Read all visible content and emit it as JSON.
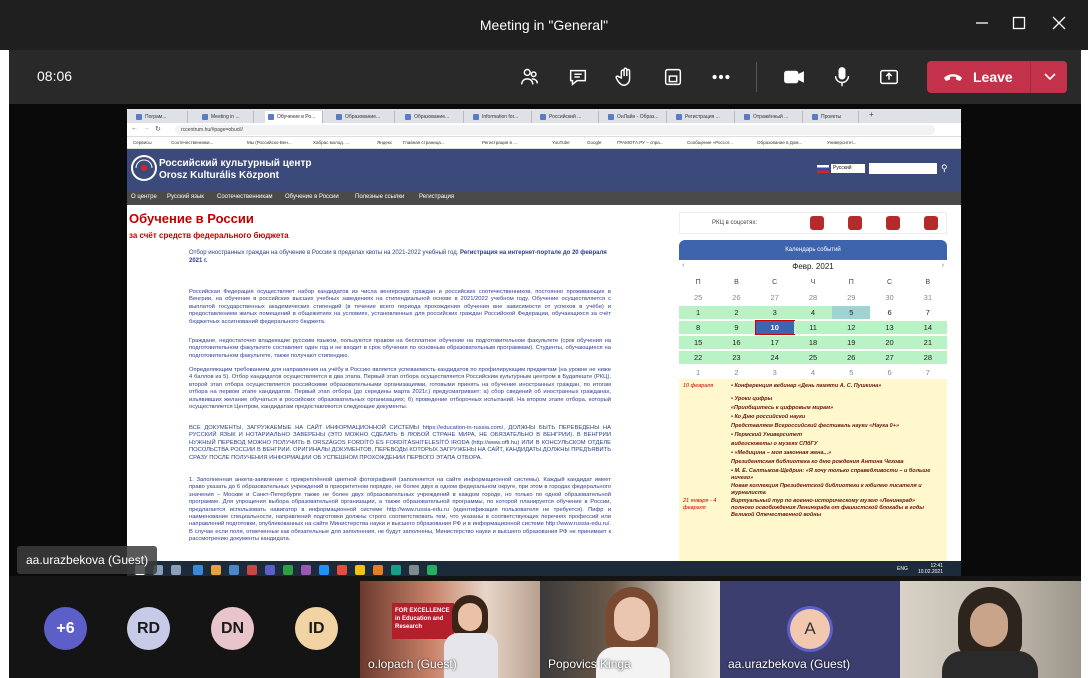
{
  "window": {
    "title": "Meeting in \"General\""
  },
  "toolbar": {
    "timer": "08:06",
    "leave_label": "Leave"
  },
  "browser": {
    "tabs": [
      "Пограм...",
      "Meeting in ...",
      "Обучение в Ро...",
      "Образование...",
      "Образование...",
      "Information for...",
      "Российский ...",
      "ОнЛайн - Образ...",
      "Регистрация ...",
      "Отражённый ...",
      "Проекты"
    ],
    "address": "rccentrum.hu/#page=obucil/",
    "bookmarks": [
      "Сервисы",
      "Соотечественники...",
      "Мы (Российско-Вен...",
      "Хабрас молод. ...",
      "Яндекс",
      "Главная страница...",
      "Регистрация в ...",
      "YouTube",
      "Google",
      "ГРАМОТА.РУ – спра...",
      "Сообщение «Россот...",
      "Образование в Дом...",
      "Университет..."
    ]
  },
  "site": {
    "name_ru": "Российский культурный центр",
    "name_hu": "Orosz Kulturális Központ",
    "language": "Русский",
    "nav": [
      "О центре",
      "Русский язык",
      "Соотечественникам",
      "Обучение в России",
      "Полезные ссылки",
      "Регистрация"
    ],
    "heading": "Обучение в России",
    "subheading": "за счёт средств федерального бюджета",
    "intro_plain": "Отбор иностранных граждан на обучение в России в пределах квоты на 2021-2022 учебный год. ",
    "intro_bold": "Регистрация на интернет-портале до 20 февраля 2021 г.",
    "paragraphs": [
      "Российская Федерация осуществляет набор кандидатов из числа венгерских граждан и российских соотечественников, постоянно проживающих в Венгрии, на обучение в российских высших учебных заведениях на стипендиальной основе в 2021/2022 учебном году. Обучение осуществляется с выплатой государственных академических стипендий (в течение всего периода прохождения обучения вне зависимости от успехов в учёбе) и предоставлением жилых помещений в общежитиях на условиях, установленных для российских граждан Российской Федерации, обучающихся за счёт бюджетных ассигнований федерального бюджета.",
      "Граждане, недостаточно владеющие русским языком, пользуются правом на бесплатное обучение на подготовительном факультете (срок обучения на подготовительном факультете составляет один год и не входит в срок обучения по основным образовательным программам). Студенты, обучающиеся на подготовительном факультете, также получают стипендию.",
      "Определяющим требованием для направления на учёбу в Россию является успеваемость кандидатов по профилирующим предметам (на уровне не ниже 4 баллов из 5). Отбор кандидатов осуществляется в два этапа. Первый этап отбора осуществляется Российским культурным центром в Будапеште (РКЦ), второй этап отбора осуществляется российскими образовательными организациями, готовыми принять на обучение иностранных граждан, по итогам отбора на первом этапе кандидатов. Первый этап отбора (до середины марта 2021г.) предусматривает: а) сбор сведений об иностранных гражданах, изъявивших желание обучаться в российских образовательных организациях; б) проведение отборочных испытаний. На втором этапе отбора, который осуществляется Центром, кандидатам предоставляются следующие документы.",
      "ВСЕ ДОКУМЕНТЫ, ЗАГРУЖАЕМЫЕ НА САЙТ ИНФОРМАЦИОННОЙ СИСТЕМЫ https://education-in-russia.com/, ДОЛЖНЫ БЫТЬ ПЕРЕВЕДЕНЫ НА РУССКИЙ ЯЗЫК И НОТАРИАЛЬНО ЗАВЕРЕНЫ (ЭТО МОЖНО СДЕЛАТЬ В ЛЮБОЙ СТРАНЕ МИРА, НЕ ОБЯЗАТЕЛЬНО В ВЕНГРИИ). В ВЕНГРИИ НУЖНЫЙ ПЕРЕВОД МОЖНО ПОЛУЧИТЬ В ORSZÁGOS FORDÍTÓ ÉS FORDÍTÁSHITELESÍTŐ IRODA (http://www.offi.hu) ИЛИ В КОНСУЛЬСКОМ ОТДЕЛЕ ПОСОЛЬСТВА РОССИИ В ВЕНГРИИ. ОРИГИНАЛЫ ДОКУМЕНТОВ, ПЕРЕВОДЫ КОТОРЫХ ЗАГРУЖЕНЫ НА САЙТ, КАНДИДАТЫ ДОЛЖНЫ ПРЕДЪЯВИТЬ СРАЗУ ПОСЛЕ ПОЛУЧЕНИЯ ИНФОРМАЦИИ ОБ УСПЕШНОМ ПРОХОЖДЕНИИ ПЕРВОГО ЭТАПА ОТБОРА.",
      "1. Заполненная анкета-заявление с прикреплённой цветной фотографией (заполняется на сайте информационной системы). Каждый кандидат имеет право указать до 6 образовательных учреждений в приоритетном порядке, не более двух в одном федеральном округе, при этом в городах федерального значения – Москве и Санкт-Петербурге также не более двух образовательных учреждений в каждом городе, но только по одной образовательной программе. Для упрощения выбора образовательной организации, а также образовательной программы, по которой планируется обучение в России, предлагается использовать навигатор в информационной системе http://www.russia-edu.ru (идентификация пользователя не требуется). Пифр и наименование специальности, направлений подготовки должны строго соответствовать тем, что указаны в соответствующих перечнях профессий или направлений подготовки, опубликованных на сайте Министерства науки и высшего образования РФ и в информационной системе http://www.russia-edu.ru/. В случае если поля, отмеченные как обязательные для заполнения, не будут заполнены, Министерство науки и высшего образования РФ не принимает к рассмотрению документы кандидата."
    ],
    "socials_label": "РКЦ в соцсетях:",
    "calendar": {
      "title": "Календарь событий",
      "month": "Февр. 2021",
      "prev": "‹",
      "next": "›",
      "weekdays": [
        "П",
        "В",
        "С",
        "Ч",
        "П",
        "С",
        "В"
      ],
      "days": [
        "25",
        "26",
        "27",
        "28",
        "29",
        "30",
        "31",
        "1",
        "2",
        "3",
        "4",
        "5",
        "6",
        "7",
        "8",
        "9",
        "10",
        "11",
        "12",
        "13",
        "14",
        "15",
        "16",
        "17",
        "18",
        "19",
        "20",
        "21",
        "22",
        "23",
        "24",
        "25",
        "26",
        "27",
        "28",
        "1",
        "2",
        "3",
        "4",
        "5",
        "6",
        "7"
      ]
    },
    "events": [
      {
        "date": "10 февраля",
        "text": "• Конференция вебинар «День памяти А. С. Пушкина»"
      },
      {
        "date": "",
        "text": "• Уроки цифры"
      },
      {
        "date": "",
        "text": "«Приобщитесь к цифровым мирам»"
      },
      {
        "date": "",
        "text": "• Ко Дню российской науки"
      },
      {
        "date": "",
        "text": "Представляем Всероссийский фестиваль науки «Наука 0+»"
      },
      {
        "date": "",
        "text": "• Пермский Университет"
      },
      {
        "date": "",
        "text": "видеосюжеты о музеях СПбГУ"
      },
      {
        "date": "",
        "text": "• «Медицина – моя законная жена...»"
      },
      {
        "date": "",
        "text": "Президентская библиотека ко дню рождения Антона Чехова"
      },
      {
        "date": "",
        "text": "• М. Е. Салтыков-Щедрин: «Я хочу только справедливости – и больше ничего»"
      },
      {
        "date": "",
        "text": "Новая коллекция Президентской библиотеки к юбилею писателя и журналиста"
      },
      {
        "date": "21 января - 4 февраля",
        "text": "Виртуальный тур по военно-историческому музею «Ленинград» полного освобождения Ленинграда от фашистской блокады в годы Великой Отечественной войны"
      }
    ],
    "taskbar": {
      "lang": "ENG",
      "time": "12:41",
      "date": "10.02.2021"
    }
  },
  "stage": {
    "presenter_label": "aa.urazbekova (Guest)"
  },
  "participants": {
    "overflow": "+6",
    "avatars": [
      "RD",
      "DN",
      "ID"
    ],
    "tiles": [
      {
        "name": "o.lopach (Guest)",
        "poster": "FOR EXCELLENCE\nin Education and Research"
      },
      {
        "name": "Popovics Kinga"
      },
      {
        "name": "aa.urazbekova (Guest)",
        "initial": "A"
      },
      {
        "name": ""
      }
    ]
  },
  "colors": {
    "leave": "#c4314b",
    "accent": "#3d64ad",
    "heading": "#c00000"
  }
}
